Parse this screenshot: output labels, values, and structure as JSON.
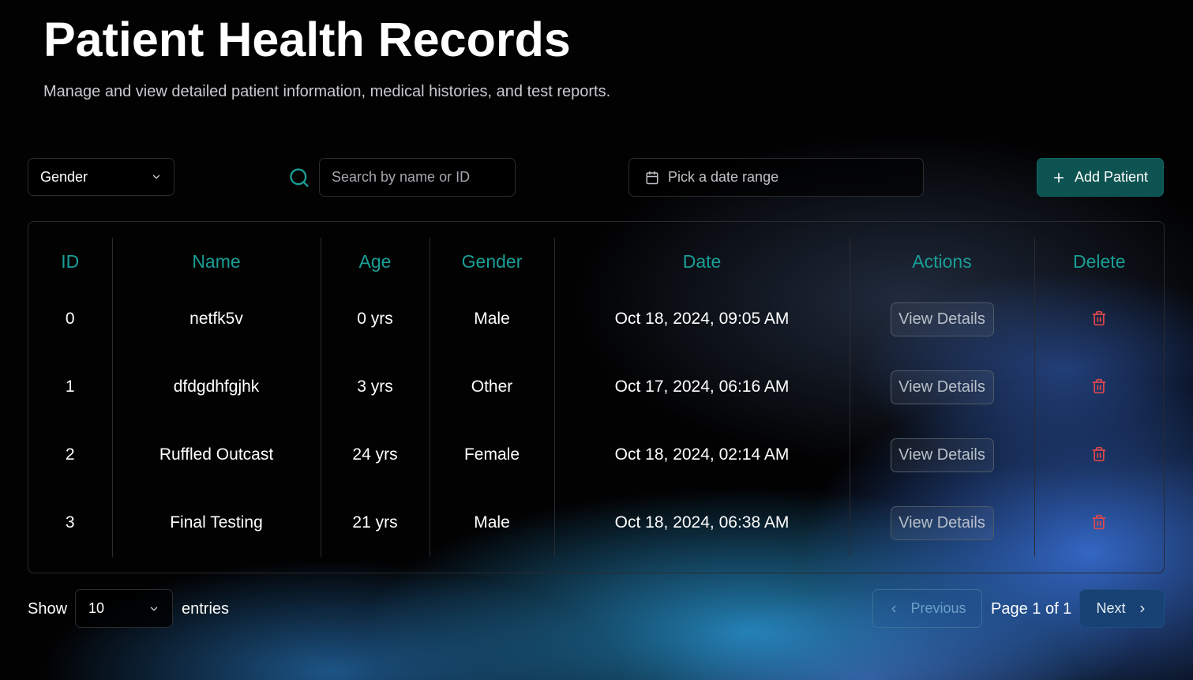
{
  "header": {
    "title": "Patient Health Records",
    "subtitle": "Manage and view detailed patient information, medical histories, and test reports."
  },
  "toolbar": {
    "gender_filter": "Gender",
    "search_placeholder": "Search by name or ID",
    "date_range_placeholder": "Pick a date range",
    "add_patient_label": "Add Patient"
  },
  "table": {
    "columns": [
      "ID",
      "Name",
      "Age",
      "Gender",
      "Date",
      "Actions",
      "Delete"
    ],
    "rows": [
      {
        "id": "0",
        "name": "netfk5v",
        "age": "0 yrs",
        "gender": "Male",
        "date": "Oct 18, 2024, 09:05 AM",
        "action_label": "View Details"
      },
      {
        "id": "1",
        "name": "dfdgdhfgjhk",
        "age": "3 yrs",
        "gender": "Other",
        "date": "Oct 17, 2024, 06:16 AM",
        "action_label": "View Details"
      },
      {
        "id": "2",
        "name": "Ruffled Outcast",
        "age": "24 yrs",
        "gender": "Female",
        "date": "Oct 18, 2024, 02:14 AM",
        "action_label": "View Details"
      },
      {
        "id": "3",
        "name": "Final Testing",
        "age": "21 yrs",
        "gender": "Male",
        "date": "Oct 18, 2024, 06:38 AM",
        "action_label": "View Details"
      }
    ]
  },
  "footer": {
    "show_label": "Show",
    "entries_value": "10",
    "entries_label": "entries",
    "previous_label": "Previous",
    "page_label": "Page 1 of 1",
    "next_label": "Next"
  },
  "colors": {
    "accent_teal": "#1a9e97",
    "add_button": "#0d5351",
    "delete_red": "#e0484c",
    "next_button": "#174273"
  },
  "icons": {
    "gender_chevron": "chevron-down-icon",
    "search": "search-icon",
    "date": "calendar-icon",
    "add": "plus-icon",
    "delete": "trash-icon",
    "entries_chevron": "chevron-down-icon",
    "previous": "chevron-left-icon",
    "next": "chevron-right-icon"
  }
}
